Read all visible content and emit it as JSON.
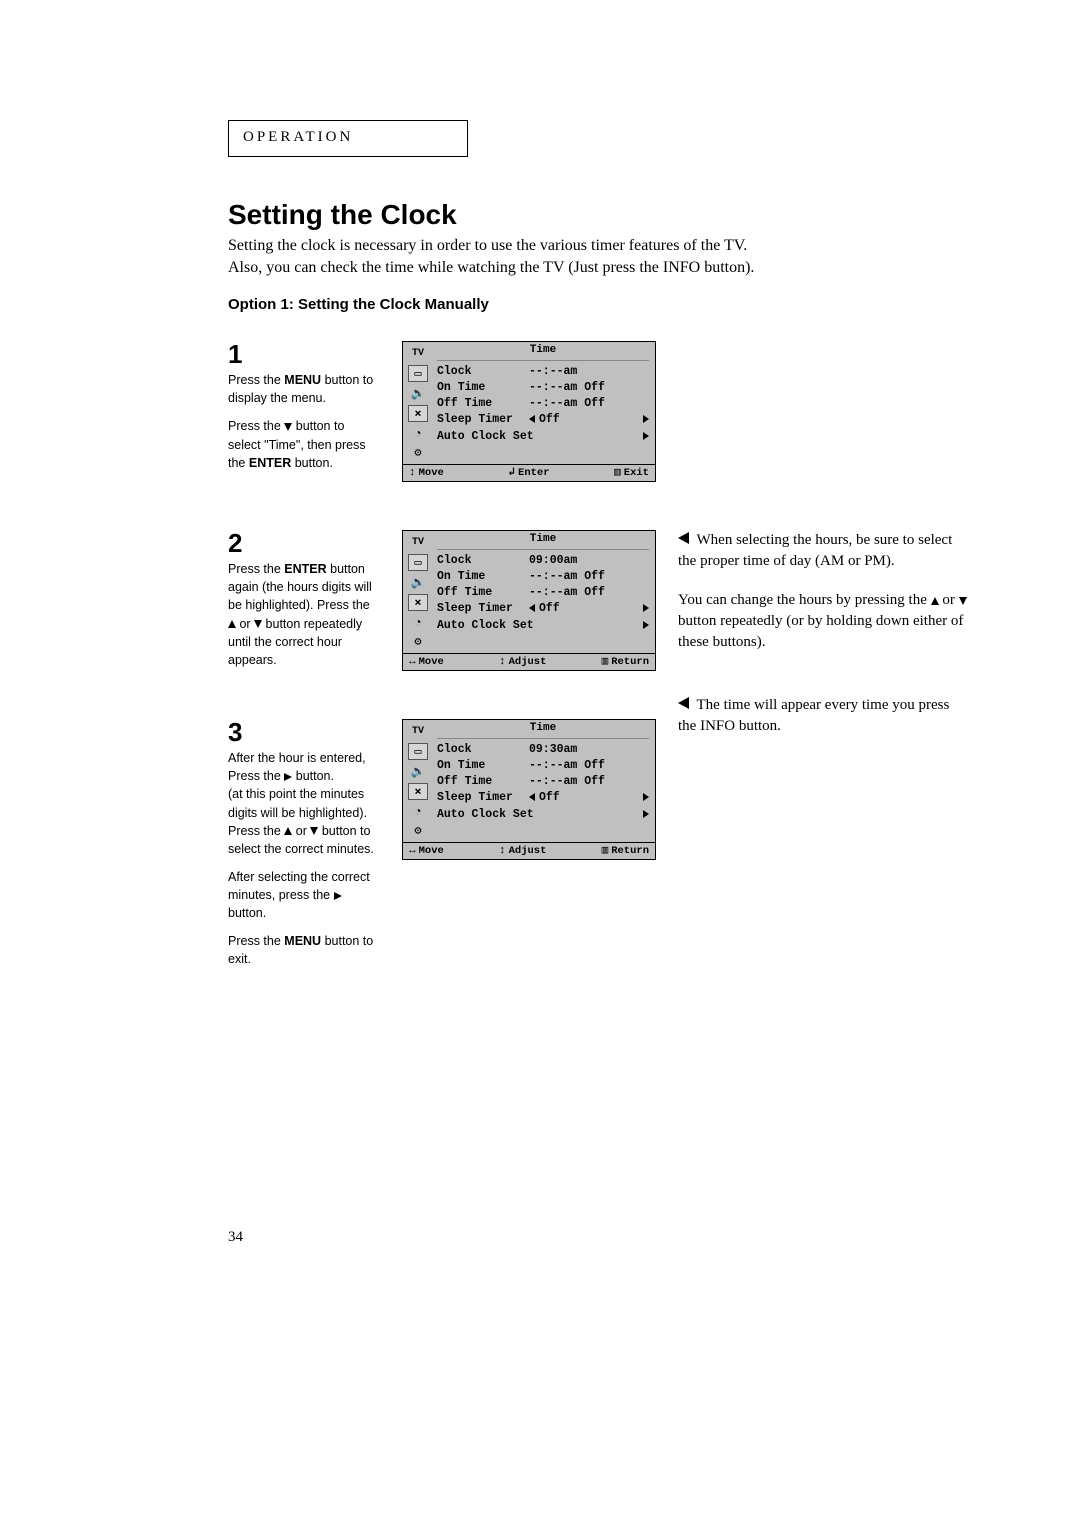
{
  "section_label": "OPERATION",
  "title": "Setting the Clock",
  "intro_line1": "Setting the clock is necessary in order to use the various timer features of the TV.",
  "intro_line2": "Also, you can check the time while watching the TV (Just press the INFO button).",
  "option_heading": "Option 1: Setting the Clock Manually",
  "page_number": "34",
  "labels": {
    "menu": "MENU",
    "enter": "ENTER"
  },
  "steps": {
    "s1": {
      "num": "1",
      "p1a": "Press the ",
      "p1b": " button to display the menu.",
      "p2a": "Press the ",
      "p2b": " button to select \"Time\", then press the ",
      "p2c": " button."
    },
    "s2": {
      "num": "2",
      "p1a": "Press the ",
      "p1b": " button again (the hours digits will be highlighted). Press the ",
      "p1c": " or ",
      "p1d": " button repeatedly until the correct hour appears."
    },
    "s3": {
      "num": "3",
      "p1a": "After the hour is entered, Press the ",
      "p1b": " button.",
      "p1c": "(at this point the minutes digits will be highlighted). Press the ",
      "p1d": " or ",
      "p1e": " button to select the correct minutes.",
      "p2a": "After selecting the correct minutes, press the ",
      "p2b": " button.",
      "p3a": "Press the ",
      "p3b": " button to exit."
    }
  },
  "osd": {
    "tv": "TV",
    "title": "Time",
    "rows": {
      "clock": "Clock",
      "on_time": "On Time",
      "off_time": "Off Time",
      "sleep_timer": "Sleep Timer",
      "auto_clock": "Auto Clock Set"
    },
    "val_dash_am": "--:--am",
    "val_dash_am_off": "--:--am Off",
    "val_off": "Off",
    "clock2": "09:00am",
    "clock3": "09:30am",
    "footer": {
      "move": "Move",
      "enter": "Enter",
      "exit": "Exit",
      "adjust": "Adjust",
      "return": "Return"
    }
  },
  "notes": {
    "n2a": "When selecting the hours, be sure to select the proper time of day (AM or PM).",
    "n2b_a": "You can change the hours by pressing the ",
    "n2b_b": " or ",
    "n2b_c": " button repeatedly (or by holding down either of these buttons).",
    "n3": "The time will appear every time you press the INFO button."
  }
}
